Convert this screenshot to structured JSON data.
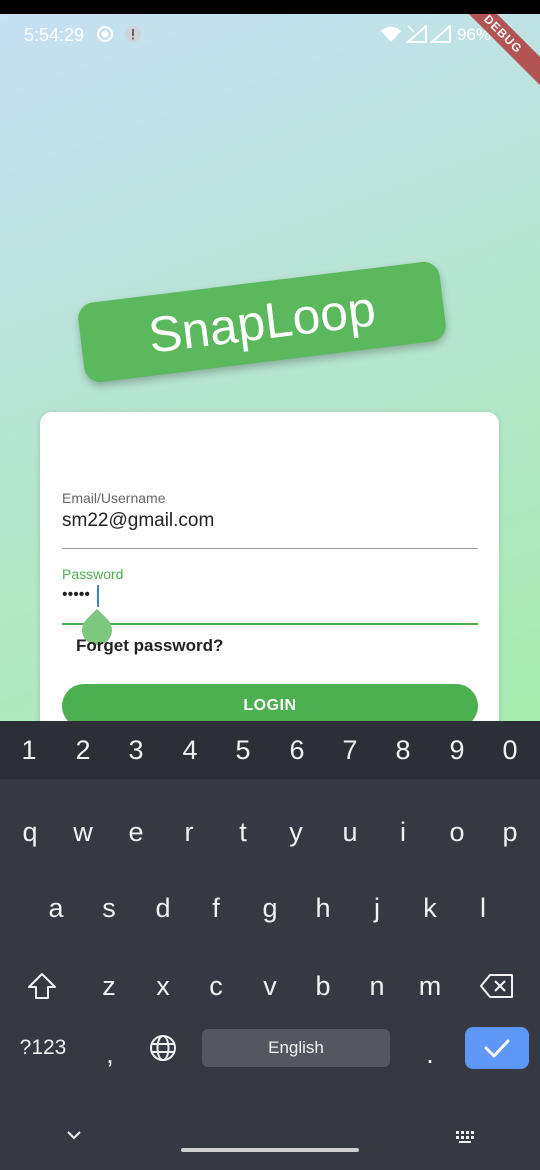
{
  "status": {
    "time": "5:54:29",
    "battery": "96%",
    "debug": "DEBUG"
  },
  "app": {
    "logo": "SnapLoop"
  },
  "login": {
    "email_label": "Email/Username",
    "email_value": "sm22@gmail.com",
    "password_label": "Password",
    "password_value": "•••••",
    "forgot": "Forget password?",
    "button": "LOGIN"
  },
  "keyboard": {
    "numbers": [
      "1",
      "2",
      "3",
      "4",
      "5",
      "6",
      "7",
      "8",
      "9",
      "0"
    ],
    "row1": [
      "q",
      "w",
      "e",
      "r",
      "t",
      "y",
      "u",
      "i",
      "o",
      "p"
    ],
    "row2": [
      "a",
      "s",
      "d",
      "f",
      "g",
      "h",
      "j",
      "k",
      "l"
    ],
    "row3": [
      "z",
      "x",
      "c",
      "v",
      "b",
      "n",
      "m"
    ],
    "symbols": "?123",
    "comma": ",",
    "space": "English",
    "period": "."
  },
  "colors": {
    "accent": "#4caf50",
    "logo_bg": "#5cb85c",
    "enter_key": "#5e97f6"
  }
}
